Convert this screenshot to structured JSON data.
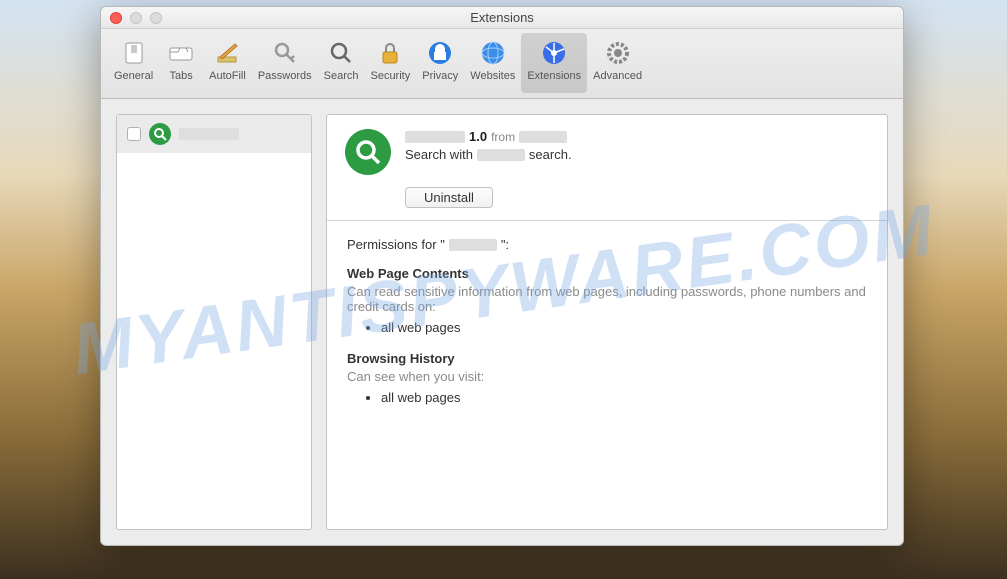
{
  "watermark": "MYANTISPYWARE.COM",
  "window_title": "Extensions",
  "toolbar": [
    {
      "name": "general",
      "label": "General"
    },
    {
      "name": "tabs",
      "label": "Tabs"
    },
    {
      "name": "autofill",
      "label": "AutoFill"
    },
    {
      "name": "passwords",
      "label": "Passwords"
    },
    {
      "name": "search",
      "label": "Search"
    },
    {
      "name": "security",
      "label": "Security"
    },
    {
      "name": "privacy",
      "label": "Privacy"
    },
    {
      "name": "websites",
      "label": "Websites"
    },
    {
      "name": "extensions",
      "label": "Extensions",
      "active": true
    },
    {
      "name": "advanced",
      "label": "Advanced"
    }
  ],
  "sidebar": {
    "items": [
      {
        "checked": false,
        "name_redacted": true
      }
    ]
  },
  "detail": {
    "name_redacted": true,
    "version": "1.0",
    "from_label": "from",
    "publisher_redacted": true,
    "description_prefix": "Search with",
    "description_mid_redacted": true,
    "description_suffix": "search.",
    "uninstall_label": "Uninstall"
  },
  "permissions": {
    "heading_prefix": "Permissions for \"",
    "heading_name_redacted": true,
    "heading_suffix": "\":",
    "sections": [
      {
        "title": "Web Page Contents",
        "desc": "Can read sensitive information from web pages, including passwords, phone numbers and credit cards on:",
        "items": [
          "all web pages"
        ]
      },
      {
        "title": "Browsing History",
        "desc": "Can see when you visit:",
        "items": [
          "all web pages"
        ]
      }
    ]
  }
}
